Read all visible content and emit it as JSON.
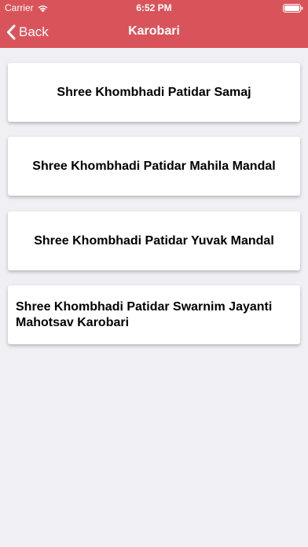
{
  "status_bar": {
    "carrier": "Carrier",
    "time": "6:52 PM",
    "wifi_icon": "wifi-icon",
    "battery_icon": "battery-icon"
  },
  "nav": {
    "back_label": "Back",
    "back_icon": "chevron-left-icon",
    "title": "Karobari"
  },
  "colors": {
    "nav_background": "#d9545a",
    "page_background": "#efeff4",
    "card_background": "#ffffff"
  },
  "items": [
    {
      "label": "Shree Khombhadi Patidar Samaj"
    },
    {
      "label": "Shree Khombhadi Patidar Mahila Mandal"
    },
    {
      "label": "Shree Khombhadi Patidar Yuvak Mandal"
    },
    {
      "label": "Shree Khombhadi Patidar Swarnim Jayanti Mahotsav Karobari"
    }
  ]
}
